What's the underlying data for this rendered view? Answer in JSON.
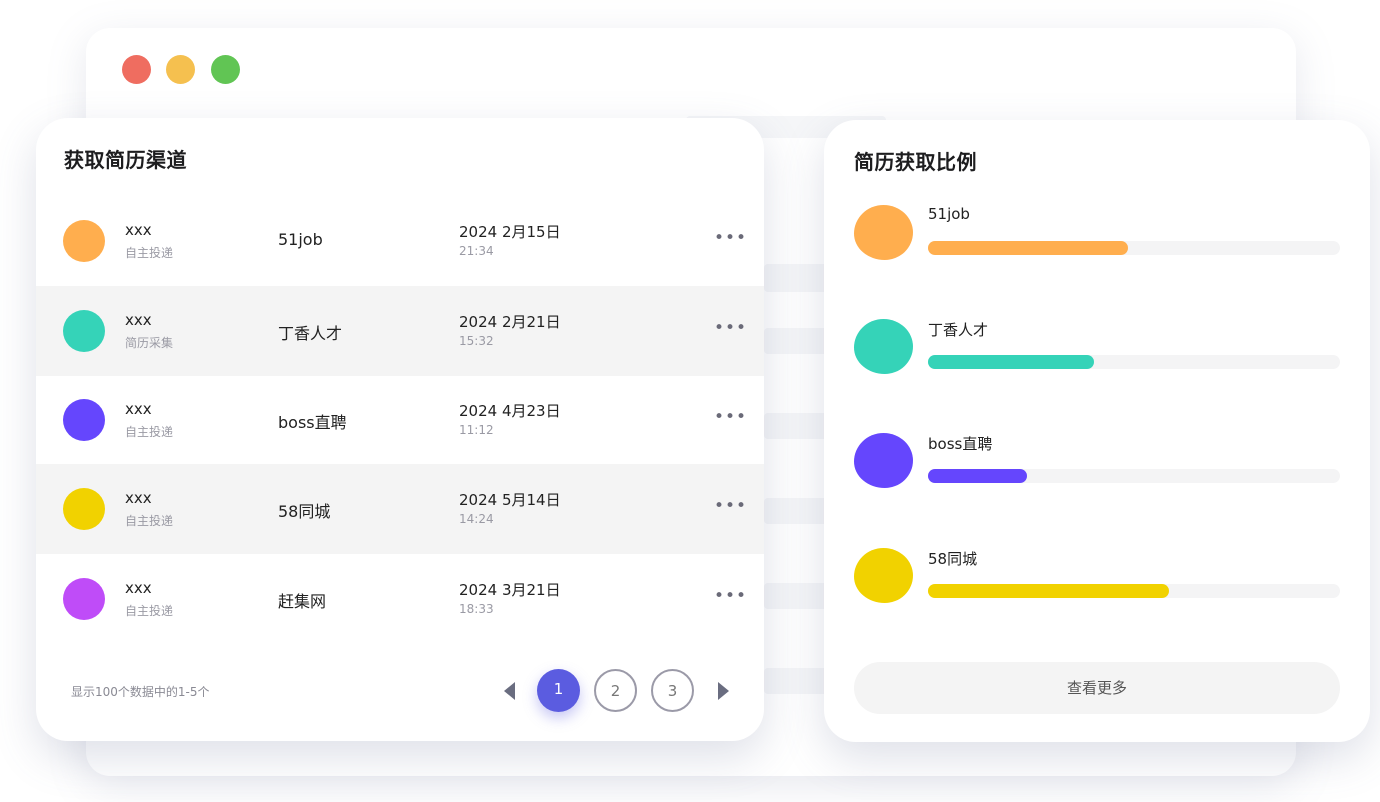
{
  "window": {
    "dots": [
      "#ef6d60",
      "#f5c04f",
      "#61c554"
    ]
  },
  "channels": {
    "title": "获取简历渠道",
    "rows": [
      {
        "name": "xxx",
        "source": "自主投递",
        "channel": "51job",
        "date": "2024 2月15日",
        "time": "21:34",
        "color": "#ffae4e"
      },
      {
        "name": "xxx",
        "source": "简历采集",
        "channel": "丁香人才",
        "date": "2024 2月21日",
        "time": "15:32",
        "color": "#35d3b8"
      },
      {
        "name": "xxx",
        "source": "自主投递",
        "channel": "boss直聘",
        "date": "2024 4月23日",
        "time": "11:12",
        "color": "#6546fd"
      },
      {
        "name": "xxx",
        "source": "自主投递",
        "channel": "58同城",
        "date": "2024 5月14日",
        "time": "14:24",
        "color": "#f1d200"
      },
      {
        "name": "xxx",
        "source": "自主投递",
        "channel": "赶集网",
        "date": "2024 3月21日",
        "time": "18:33",
        "color": "#bf4cf8"
      }
    ],
    "more_glyph": "•••",
    "footer": "显示100个数据中的1-5个",
    "pages": [
      "1",
      "2",
      "3"
    ],
    "current_page": "1"
  },
  "ratio": {
    "title": "简历获取比例",
    "items": [
      {
        "label": "51job",
        "fraction": 0.485,
        "color": "#ffae4e"
      },
      {
        "label": "丁香人才",
        "fraction": 0.403,
        "color": "#35d3b8"
      },
      {
        "label": "boss直聘",
        "fraction": 0.24,
        "color": "#6546fd"
      },
      {
        "label": "58同城",
        "fraction": 0.585,
        "color": "#f1d200"
      }
    ],
    "more_label": "查看更多"
  }
}
